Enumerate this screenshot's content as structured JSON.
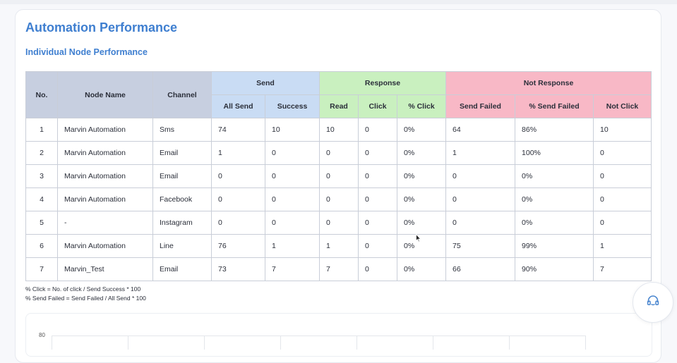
{
  "page": {
    "title": "Automation Performance",
    "section_title": "Individual Node Performance"
  },
  "table": {
    "headers": {
      "no": "No.",
      "node_name": "Node Name",
      "channel": "Channel",
      "send": "Send",
      "response": "Response",
      "not_response": "Not Response",
      "all_send": "All Send",
      "success": "Success",
      "read": "Read",
      "click": "Click",
      "pct_click": "% Click",
      "send_failed": "Send Failed",
      "pct_send_failed": "% Send Failed",
      "not_click": "Not Click"
    },
    "rows": [
      [
        "1",
        "Marvin Automation",
        "Sms",
        "74",
        "10",
        "10",
        "0",
        "0%",
        "64",
        "86%",
        "10"
      ],
      [
        "2",
        "Marvin Automation",
        "Email",
        "1",
        "0",
        "0",
        "0",
        "0%",
        "1",
        "100%",
        "0"
      ],
      [
        "3",
        "Marvin Automation",
        "Email",
        "0",
        "0",
        "0",
        "0",
        "0%",
        "0",
        "0%",
        "0"
      ],
      [
        "4",
        "Marvin Automation",
        "Facebook",
        "0",
        "0",
        "0",
        "0",
        "0%",
        "0",
        "0%",
        "0"
      ],
      [
        "5",
        "-",
        "Instagram",
        "0",
        "0",
        "0",
        "0",
        "0%",
        "0",
        "0%",
        "0"
      ],
      [
        "6",
        "Marvin Automation",
        "Line",
        "76",
        "1",
        "1",
        "0",
        "0%",
        "75",
        "99%",
        "1"
      ],
      [
        "7",
        "Marvin_Test",
        "Email",
        "73",
        "7",
        "7",
        "0",
        "0%",
        "66",
        "90%",
        "7"
      ]
    ]
  },
  "notes": {
    "click_formula": "% Click = No. of click / Send Success * 100",
    "send_failed_formula": "% Send Failed = Send Failed / All Send * 100"
  },
  "chart": {
    "top_tick": "80"
  },
  "colors": {
    "title": "#3f7fd0",
    "header_base": "#c7cfe0",
    "header_send": "#c9dcf4",
    "header_response": "#c9f0bf",
    "header_not_response": "#f8b8c6"
  },
  "icons": {
    "support": "headset-icon"
  }
}
